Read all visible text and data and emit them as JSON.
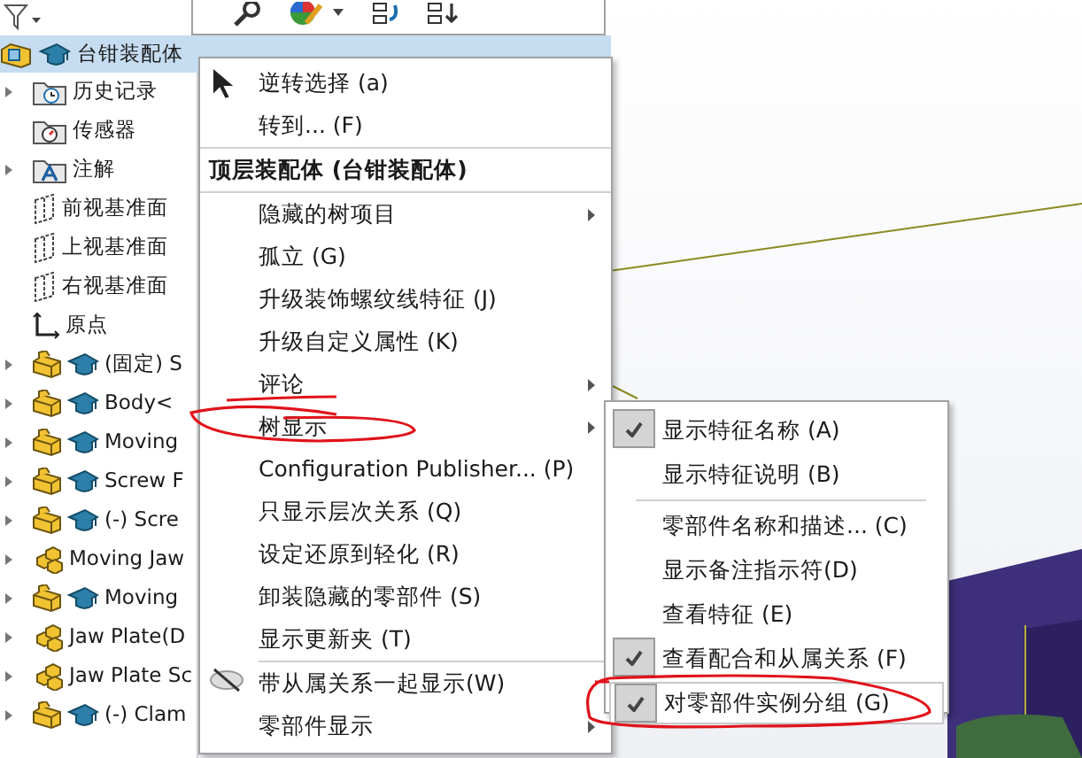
{
  "tree": {
    "root": {
      "label": "台钳装配体",
      "selected": true
    },
    "items": [
      {
        "label": "历史记录",
        "kind": "history",
        "expandable": true
      },
      {
        "label": "传感器",
        "kind": "sensor",
        "expandable": false
      },
      {
        "label": "注解",
        "kind": "annotation",
        "expandable": true
      },
      {
        "label": "前视基准面",
        "kind": "plane",
        "expandable": false
      },
      {
        "label": "上视基准面",
        "kind": "plane",
        "expandable": false
      },
      {
        "label": "右视基准面",
        "kind": "plane",
        "expandable": false
      },
      {
        "label": "原点",
        "kind": "origin",
        "expandable": false
      },
      {
        "label": "(固定) S",
        "kind": "part",
        "expandable": true
      },
      {
        "label": "Body<",
        "kind": "part",
        "expandable": true
      },
      {
        "label": "Moving",
        "kind": "part",
        "expandable": true
      },
      {
        "label": "Screw F",
        "kind": "part",
        "expandable": true
      },
      {
        "label": "(-) Scre",
        "kind": "part",
        "expandable": true
      },
      {
        "label": "Moving Jaw",
        "kind": "assembly",
        "expandable": true
      },
      {
        "label": "Moving",
        "kind": "part",
        "expandable": true
      },
      {
        "label": "Jaw Plate(D",
        "kind": "assembly",
        "expandable": true
      },
      {
        "label": "Jaw Plate Sc",
        "kind": "assembly",
        "expandable": true
      },
      {
        "label": "(-) Clam",
        "kind": "part",
        "expandable": true
      }
    ]
  },
  "context_menu": {
    "items": [
      {
        "kind": "cursor",
        "label": "逆转选择 (a)",
        "submenu": false
      },
      {
        "kind": "item",
        "label": "转到... (F)",
        "submenu": false
      },
      {
        "kind": "separator"
      },
      {
        "kind": "header",
        "label": "顶层装配体 (台钳装配体)",
        "submenu": false
      },
      {
        "kind": "separator"
      },
      {
        "kind": "item",
        "label": "隐藏的树项目",
        "submenu": true
      },
      {
        "kind": "item",
        "label": "孤立 (G)",
        "submenu": false
      },
      {
        "kind": "item",
        "label": "升级装饰螺纹线特征 (J)",
        "submenu": false
      },
      {
        "kind": "item",
        "label": "升级自定义属性 (K)",
        "submenu": false
      },
      {
        "kind": "item",
        "label": "评论",
        "submenu": true
      },
      {
        "kind": "item",
        "label": "树显示",
        "submenu": true
      },
      {
        "kind": "item",
        "label": "Configuration Publisher... (P)",
        "submenu": false
      },
      {
        "kind": "item",
        "label": "只显示层次关系 (Q)",
        "submenu": false
      },
      {
        "kind": "item",
        "label": "设定还原到轻化 (R)",
        "submenu": false
      },
      {
        "kind": "item",
        "label": "卸装隐藏的零部件 (S)",
        "submenu": false
      },
      {
        "kind": "item",
        "label": "显示更新夹 (T)",
        "submenu": false
      },
      {
        "kind": "separator"
      },
      {
        "kind": "eye",
        "label": "带从属关系一起显示(W)",
        "submenu": false
      },
      {
        "kind": "item",
        "label": "零部件显示",
        "submenu": true
      }
    ]
  },
  "submenu": {
    "items": [
      {
        "kind": "item",
        "label": "显示特征名称 (A)",
        "checked": true,
        "selected": false
      },
      {
        "kind": "item",
        "label": "显示特征说明 (B)",
        "checked": false,
        "selected": false
      },
      {
        "kind": "separator"
      },
      {
        "kind": "item",
        "label": "零部件名称和描述... (C)",
        "checked": false,
        "selected": false
      },
      {
        "kind": "item",
        "label": "显示备注指示符(D)",
        "checked": false,
        "selected": false
      },
      {
        "kind": "item",
        "label": "查看特征 (E)",
        "checked": false,
        "selected": false
      },
      {
        "kind": "item",
        "label": "查看配合和从属关系 (F)",
        "checked": true,
        "selected": false
      },
      {
        "kind": "item",
        "label": "对零部件实例分组 (G)",
        "checked": true,
        "selected": true
      }
    ]
  }
}
